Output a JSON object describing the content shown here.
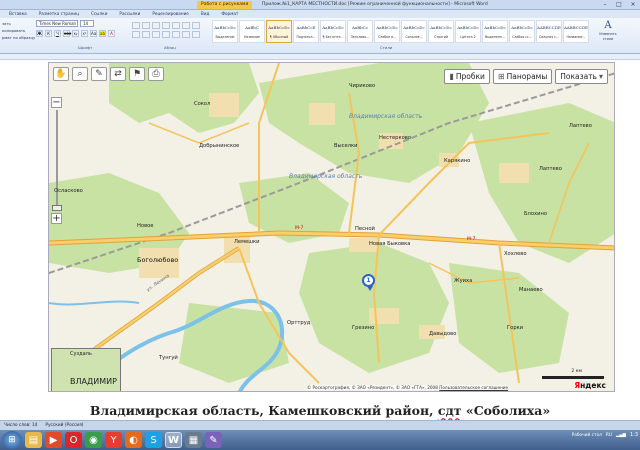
{
  "window": {
    "context_tab": "Работа с рисунками",
    "title": "Прилож.№1_КАРТА МЕСТНОСТИ.doc [Режим ограниченной функциональности] - Microsoft Word"
  },
  "ribbon": {
    "tabs": [
      "Вставка",
      "Разметка страниц",
      "Ссылки",
      "Рассылки",
      "Рецензирование",
      "Вид",
      "Формат"
    ],
    "clipboard": [
      "зать",
      "копировать",
      "рмат по образцу"
    ],
    "font_name": "Times New Roman",
    "font_size": "14",
    "group_labels": {
      "font": "Шрифт",
      "paragraph": "Абзац",
      "styles": "Стили"
    },
    "styles": [
      {
        "sample": "AaBbCcDc",
        "name": "Выделение"
      },
      {
        "sample": "AaBbC",
        "name": "Название"
      },
      {
        "sample": "AaBbCcDc",
        "name": "¶ Обычный"
      },
      {
        "sample": "AaBbCcE",
        "name": "Подзагол..."
      },
      {
        "sample": "AaBbCcDc",
        "name": "¶ Без инте..."
      },
      {
        "sample": "AaBbCc",
        "name": "Заголово..."
      },
      {
        "sample": "AaBbCcDc",
        "name": "Слабое в..."
      },
      {
        "sample": "AaBbCcDc",
        "name": "Сильное..."
      },
      {
        "sample": "AaBbCcDc",
        "name": "Строгий"
      },
      {
        "sample": "AaBbCcDc",
        "name": "Цитата 2"
      },
      {
        "sample": "AaBbCcDc",
        "name": "Выделенн..."
      },
      {
        "sample": "AaBbCcDc",
        "name": "Слабая сс..."
      },
      {
        "sample": "AABBCCDE",
        "name": "Сильная с..."
      },
      {
        "sample": "AABBCCDE",
        "name": "Название..."
      }
    ],
    "change_styles": "Изменить стили"
  },
  "map": {
    "buttons": {
      "traffic": "Пробки",
      "panoramas": "Панорамы",
      "show": "Показать"
    },
    "places": [
      {
        "label": "Чириково",
        "cls": "place"
      },
      {
        "label": "Сокол",
        "cls": "place"
      },
      {
        "label": "Добрынинское",
        "cls": "place"
      },
      {
        "label": "Владимирская область",
        "cls": "place region"
      },
      {
        "label": "Владимирская область",
        "cls": "place region"
      },
      {
        "label": "Нестерково",
        "cls": "place"
      },
      {
        "label": "Лаптево",
        "cls": "place"
      },
      {
        "label": "Выселки",
        "cls": "place"
      },
      {
        "label": "Карякино",
        "cls": "place"
      },
      {
        "label": "Осласково",
        "cls": "place"
      },
      {
        "label": "Лаптево",
        "cls": "place"
      },
      {
        "label": "Новое",
        "cls": "place"
      },
      {
        "label": "Песной",
        "cls": "place"
      },
      {
        "label": "Блохино",
        "cls": "place"
      },
      {
        "label": "Лемешки",
        "cls": "place"
      },
      {
        "label": "Новая Быковка",
        "cls": "place"
      },
      {
        "label": "Хохлево",
        "cls": "place"
      },
      {
        "label": "Боголюбово",
        "cls": "place big"
      },
      {
        "label": "Жуиха",
        "cls": "place"
      },
      {
        "label": "Манаево",
        "cls": "place"
      },
      {
        "label": "ул. Ленина",
        "cls": "place route"
      },
      {
        "label": "Орттруд",
        "cls": "place"
      },
      {
        "label": "Грезино",
        "cls": "place"
      },
      {
        "label": "Горки",
        "cls": "place"
      },
      {
        "label": "Давыдово",
        "cls": "place"
      },
      {
        "label": "Тунгуй",
        "cls": "place"
      },
      {
        "label": "Суздаль",
        "cls": "place"
      }
    ],
    "road_numbers": [
      "М-7",
      "М-7"
    ],
    "marker_number": "1",
    "overview": {
      "small": "Суздаль",
      "big": "ВЛАДИМИР"
    },
    "copyright": "© Роскартография, © ЗАО «Резидент», © ЗАО «ГТА», 2008",
    "terms": "Пользовательское соглашение",
    "scale_label": "2 км",
    "logo_red": "Я",
    "logo_rest": "ндекс"
  },
  "caption": {
    "before": "Владимирская область, Камешковский район,",
    "sdt": "сдт",
    "after": "«Соболиха»"
  },
  "status": {
    "page": "Число слов: 14",
    "language": "Русский (Россия)"
  },
  "taskbar": {
    "desktop": "Рабочий стол",
    "lang": "RU",
    "clock": "1:3"
  }
}
